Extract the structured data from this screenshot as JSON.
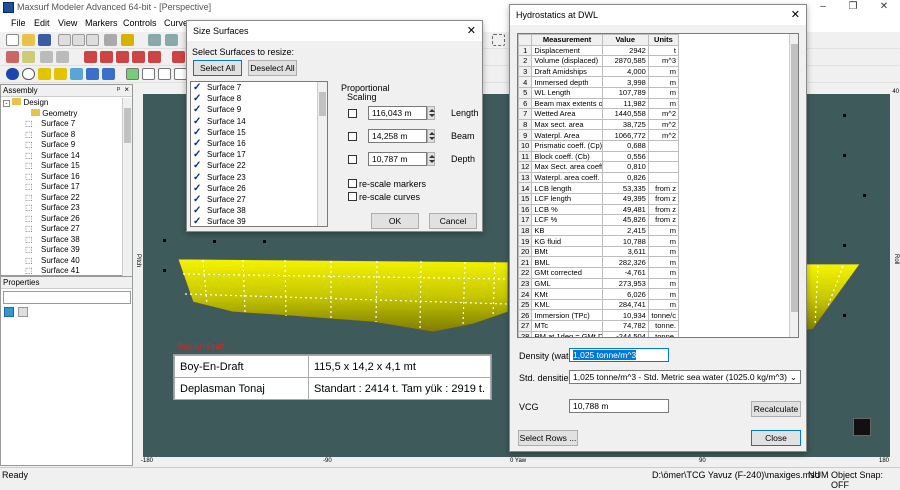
{
  "window": {
    "title": "Maxsurf Modeler Advanced 64-bit - [Perspective]",
    "minimize": "–",
    "restore": "❐",
    "close": "✕"
  },
  "menu": [
    "File",
    "Edit",
    "View",
    "Markers",
    "Controls",
    "Curves"
  ],
  "assembly": {
    "title": "Assembly",
    "pin": "ᵖ",
    "close": "×",
    "root": "Design",
    "items": [
      "Geometry",
      "Surface 7",
      "Surface 8",
      "Surface 9",
      "Surface 14",
      "Surface 15",
      "Surface 16",
      "Surface 17",
      "Surface 22",
      "Surface 23",
      "Surface 26",
      "Surface 27",
      "Surface 38",
      "Surface 39",
      "Surface 40",
      "Surface 41"
    ]
  },
  "properties": {
    "title": "Properties"
  },
  "viewport": {
    "ruler_labels": [
      "-180",
      "-90",
      "0 Yaw",
      "90",
      "180"
    ],
    "side_left": "Pitch",
    "side_right": "Roll",
    "zoom_label": "40",
    "stamp": "Boy-En-Draft ..."
  },
  "info_table": [
    [
      "Boy-En-Draft",
      "115,5 x 14,2 x 4,1 mt"
    ],
    [
      "Deplasman Tonaj",
      "Standart : 2414 t. Tam yük : 2919 t."
    ]
  ],
  "size_dialog": {
    "title": "Size Surfaces",
    "prompt": "Select Surfaces to resize:",
    "select_all": "Select All",
    "deselect_all": "Deselect All",
    "surfaces": [
      "Surface 7",
      "Surface 8",
      "Surface 9",
      "Surface 14",
      "Surface 15",
      "Surface 16",
      "Surface 17",
      "Surface 22",
      "Surface 23",
      "Surface 26",
      "Surface 27",
      "Surface 38",
      "Surface 39"
    ],
    "proportional": "Proportional",
    "scaling": "Scaling",
    "length_value": "116,043 m",
    "length_label": "Length",
    "beam_value": "14,258 m",
    "beam_label": "Beam",
    "depth_value": "10,787 m",
    "depth_label": "Depth",
    "rescale_markers": "re-scale markers",
    "rescale_curves": "re-scale curves",
    "ok": "OK",
    "cancel": "Cancel"
  },
  "hydro": {
    "title": "Hydrostatics at DWL",
    "headers": [
      "",
      "Measurement",
      "Value",
      "Units"
    ],
    "rows": [
      [
        "1",
        "Displacement",
        "2942",
        "t"
      ],
      [
        "2",
        "Volume (displaced)",
        "2870,585",
        "m^3"
      ],
      [
        "3",
        "Draft Amidships",
        "4,000",
        "m"
      ],
      [
        "4",
        "Immersed depth",
        "3,998",
        "m"
      ],
      [
        "5",
        "WL Length",
        "107,789",
        "m"
      ],
      [
        "6",
        "Beam max extents o",
        "11,982",
        "m"
      ],
      [
        "7",
        "Wetted Area",
        "1440,558",
        "m^2"
      ],
      [
        "8",
        "Max sect. area",
        "38,725",
        "m^2"
      ],
      [
        "9",
        "Waterpl. Area",
        "1066,772",
        "m^2"
      ],
      [
        "10",
        "Prismatic coeff. (Cp)",
        "0,688",
        ""
      ],
      [
        "11",
        "Block coeff. (Cb)",
        "0,556",
        ""
      ],
      [
        "12",
        "Max Sect. area coeff",
        "0,810",
        ""
      ],
      [
        "13",
        "Waterpl. area coeff.",
        "0,826",
        ""
      ],
      [
        "14",
        "LCB length",
        "53,335",
        "from z"
      ],
      [
        "15",
        "LCF length",
        "49,395",
        "from z"
      ],
      [
        "16",
        "LCB %",
        "49,481",
        "from z"
      ],
      [
        "17",
        "LCF %",
        "45,826",
        "from z"
      ],
      [
        "18",
        "KB",
        "2,415",
        "m"
      ],
      [
        "19",
        "KG fluid",
        "10,788",
        "m"
      ],
      [
        "20",
        "BMt",
        "3,611",
        "m"
      ],
      [
        "21",
        "BML",
        "282,326",
        "m"
      ],
      [
        "22",
        "GMt corrected",
        "-4,761",
        "m"
      ],
      [
        "23",
        "GML",
        "273,953",
        "m"
      ],
      [
        "24",
        "KMt",
        "6,026",
        "m"
      ],
      [
        "25",
        "KML",
        "284,741",
        "m"
      ],
      [
        "26",
        "Immersion (TPc)",
        "10,934",
        "tonne/c"
      ],
      [
        "27",
        "MTc",
        "74,782",
        "tonne."
      ],
      [
        "28",
        "RM at 1deg = GMt.Di",
        "-244,504",
        "tonne."
      ]
    ],
    "density_label": "Density (water)",
    "density_value": "1,025 tonne/m^3",
    "std_label": "Std. densities",
    "std_value": "1,025 tonne/m^3 - Std. Metric sea water (1025.0 kg/m^3)",
    "vcg_label": "VCG",
    "vcg_value": "10,788 m",
    "recalculate": "Recalculate",
    "select_rows": "Select Rows ...",
    "close": "Close"
  },
  "status": {
    "left": "Ready",
    "path": "D:\\ömer\\TCG Yavuz (F-240)\\maxiges.msd",
    "num": "NUM",
    "snap": "Object Snap: OFF"
  },
  "colors": {
    "hull": "#d8d800",
    "water": "#3e5a5a",
    "accent": "#0078d7"
  }
}
